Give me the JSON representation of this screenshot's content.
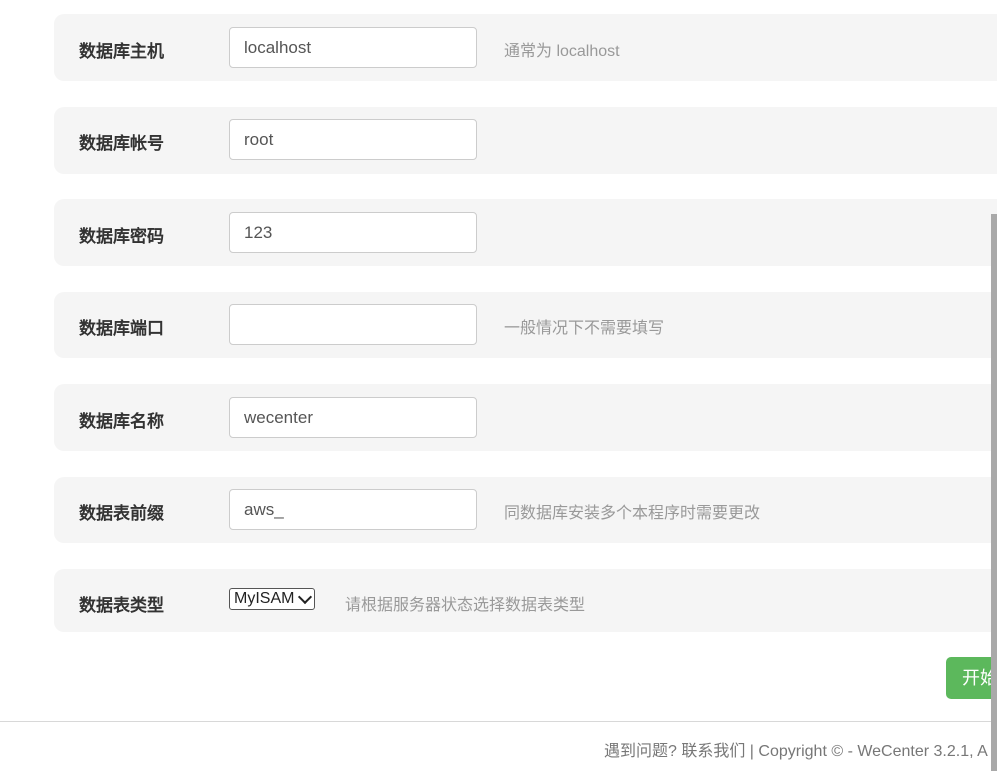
{
  "form": {
    "db_host": {
      "label": "数据库主机",
      "value": "localhost",
      "hint": "通常为 localhost"
    },
    "db_user": {
      "label": "数据库帐号",
      "value": "root"
    },
    "db_pass": {
      "label": "数据库密码",
      "value": "123"
    },
    "db_port": {
      "label": "数据库端口",
      "value": "",
      "hint": "一般情况下不需要填写"
    },
    "db_name": {
      "label": "数据库名称",
      "value": "wecenter"
    },
    "db_prefix": {
      "label": "数据表前缀",
      "value": "aws_",
      "hint": "同数据库安装多个本程序时需要更改"
    },
    "db_engine": {
      "label": "数据表类型",
      "selected": "MyISAM",
      "hint": "请根据服务器状态选择数据表类型"
    }
  },
  "submit_label": "开始",
  "footer": {
    "help_text": "遇到问题? 联系我们",
    "copyright": " | Copyright © - WeCenter 3.2.1, A"
  },
  "colors": {
    "row_background": "#f5f5f5",
    "submit_button": "#5cb85c",
    "hint_text": "#999999"
  }
}
